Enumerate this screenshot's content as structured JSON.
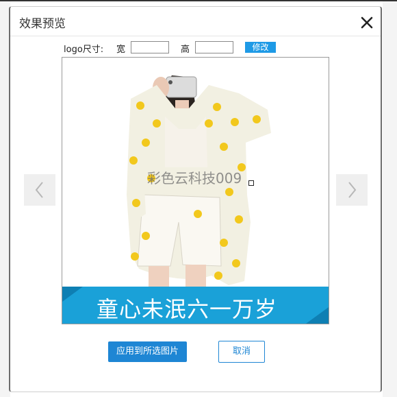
{
  "dialog": {
    "title": "效果预览",
    "close_icon": "close-icon"
  },
  "size_row": {
    "logo_label": "logo尺寸:",
    "width_label": "宽",
    "height_label": "高",
    "width_value": "",
    "height_value": "",
    "modify_label": "修改"
  },
  "preview": {
    "watermark_text": "彩色云科技009",
    "banner_text": "童心未泯六一万岁",
    "prev_icon": "chevron-left-icon",
    "next_icon": "chevron-right-icon"
  },
  "actions": {
    "apply_label": "应用到所选图片",
    "cancel_label": "取消"
  },
  "colors": {
    "accent": "#1e86d4",
    "banner": "#1aa1d8"
  }
}
